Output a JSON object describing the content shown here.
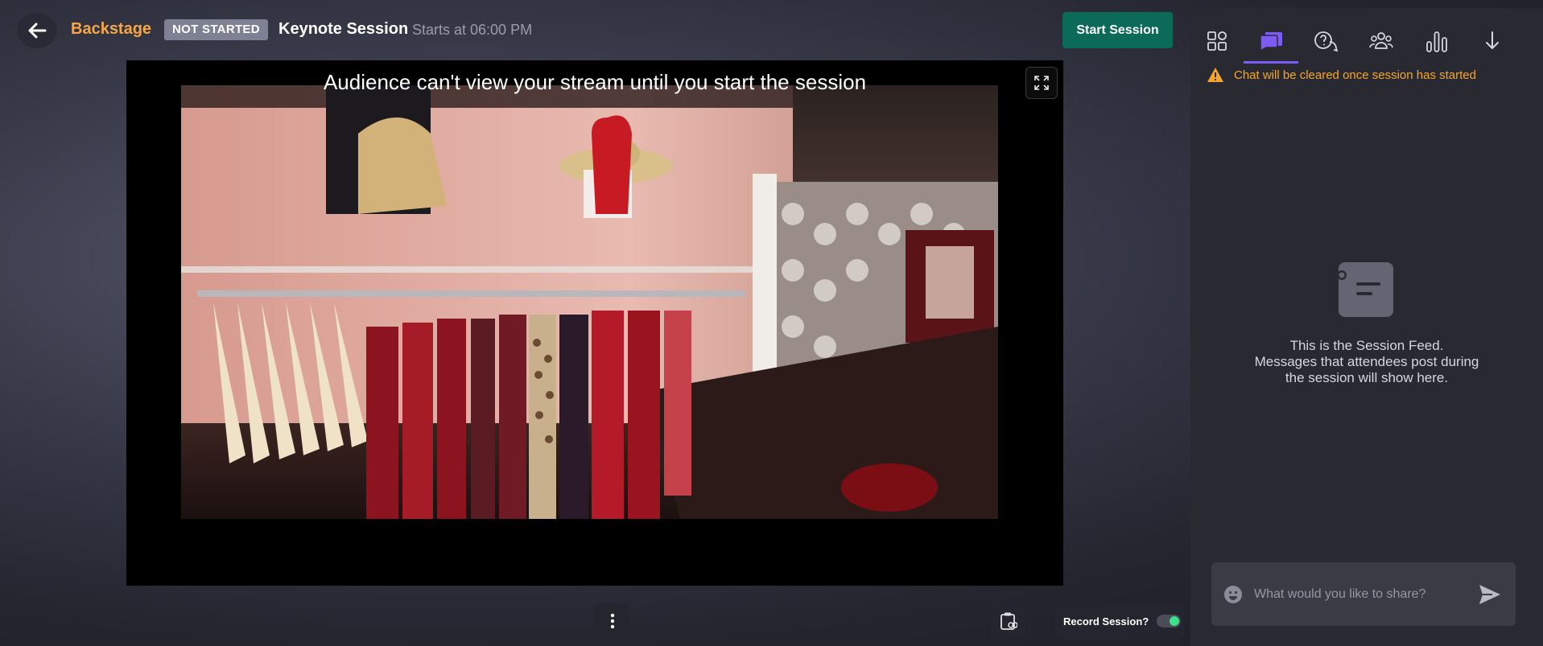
{
  "header": {
    "back_label": "Backstage",
    "status": "NOT STARTED",
    "title": "Keynote Session",
    "start_time": "Starts at 06:00 PM",
    "start_button": "Start Session"
  },
  "stage": {
    "notice": "Audience can't view your stream until you start the session"
  },
  "controls": {
    "record_label": "Record Session?",
    "record_enabled": true
  },
  "side_panel": {
    "tabs": [
      "apps",
      "chat",
      "questions",
      "people",
      "polls",
      "collapse"
    ],
    "active_tab": "chat",
    "warning": "Chat will be cleared once session has started",
    "empty_line1": "This is the Session Feed.",
    "empty_line2": "Messages that attendees post during",
    "empty_line3": "the session will show here.",
    "input_placeholder": "What would you like to share?"
  },
  "colors": {
    "accent_orange": "#f7a645",
    "start_green": "#0b6a58",
    "active_tab": "#7c5cf5",
    "warning": "#f4a62b",
    "toggle_on": "#3fe08a"
  }
}
